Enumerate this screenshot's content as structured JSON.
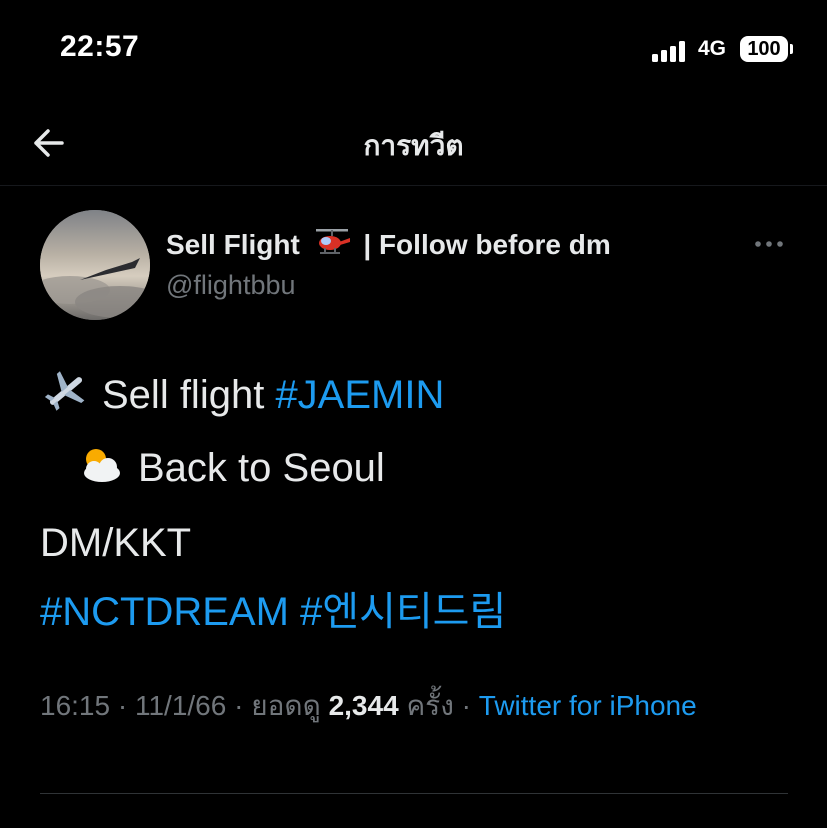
{
  "status_bar": {
    "time": "22:57",
    "network": "4G",
    "battery": "100"
  },
  "header": {
    "title": "การทวีต",
    "back_icon": "arrow-left-icon"
  },
  "tweet": {
    "author": {
      "name": "Sell Flight",
      "name_suffix": "| Follow before dm",
      "handle": "@flightbbu",
      "name_emoji": "helicopter-icon"
    },
    "lines": {
      "line1_text": "Sell flight",
      "line1_hashtag": "#JAEMIN",
      "line2_text": "Back to Seoul",
      "line3_text": "DM/KKT",
      "hashtag_nct": "#NCTDREAM",
      "hashtag_kr": "#엔시티드림"
    },
    "meta": {
      "time": "16:15",
      "sep1": " · ",
      "date": "11/1/66",
      "sep2": " · ",
      "views_label": "ยอดดู",
      "views_count": "2,344",
      "views_unit": "ครั้ง",
      "sep3": " · ",
      "source": "Twitter for iPhone"
    }
  },
  "colors": {
    "background": "#000000",
    "text": "#e7e9ea",
    "muted": "#71767b",
    "link": "#1d9bf0",
    "divider": "#2f3336"
  }
}
